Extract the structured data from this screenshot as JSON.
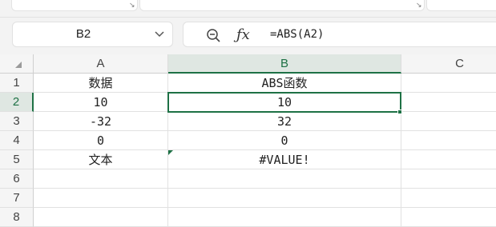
{
  "name_box": {
    "value": "B2"
  },
  "formula_bar": {
    "formula": "=ABS(A2)"
  },
  "columns": [
    {
      "label": "A",
      "active": false
    },
    {
      "label": "B",
      "active": true
    },
    {
      "label": "C",
      "active": false
    }
  ],
  "rows": [
    {
      "num": "1",
      "a": "数据",
      "b": "ABS函数",
      "c": ""
    },
    {
      "num": "2",
      "a": "10",
      "b": "10",
      "c": ""
    },
    {
      "num": "3",
      "a": "-32",
      "b": "32",
      "c": ""
    },
    {
      "num": "4",
      "a": "0",
      "b": "0",
      "c": ""
    },
    {
      "num": "5",
      "a": "文本",
      "b": "#VALUE!",
      "c": ""
    },
    {
      "num": "6",
      "a": "",
      "b": "",
      "c": ""
    },
    {
      "num": "7",
      "a": "",
      "b": "",
      "c": ""
    },
    {
      "num": "8",
      "a": "",
      "b": "",
      "c": ""
    }
  ],
  "active_cell": {
    "col": "B",
    "row": "2"
  },
  "colors": {
    "accent": "#1e7145",
    "header_bg": "#f5f5f5",
    "grid": "#e1e1e1"
  },
  "icons": [
    "launcher-icon",
    "chevron-down-icon",
    "zoom-icon",
    "fx-icon"
  ]
}
